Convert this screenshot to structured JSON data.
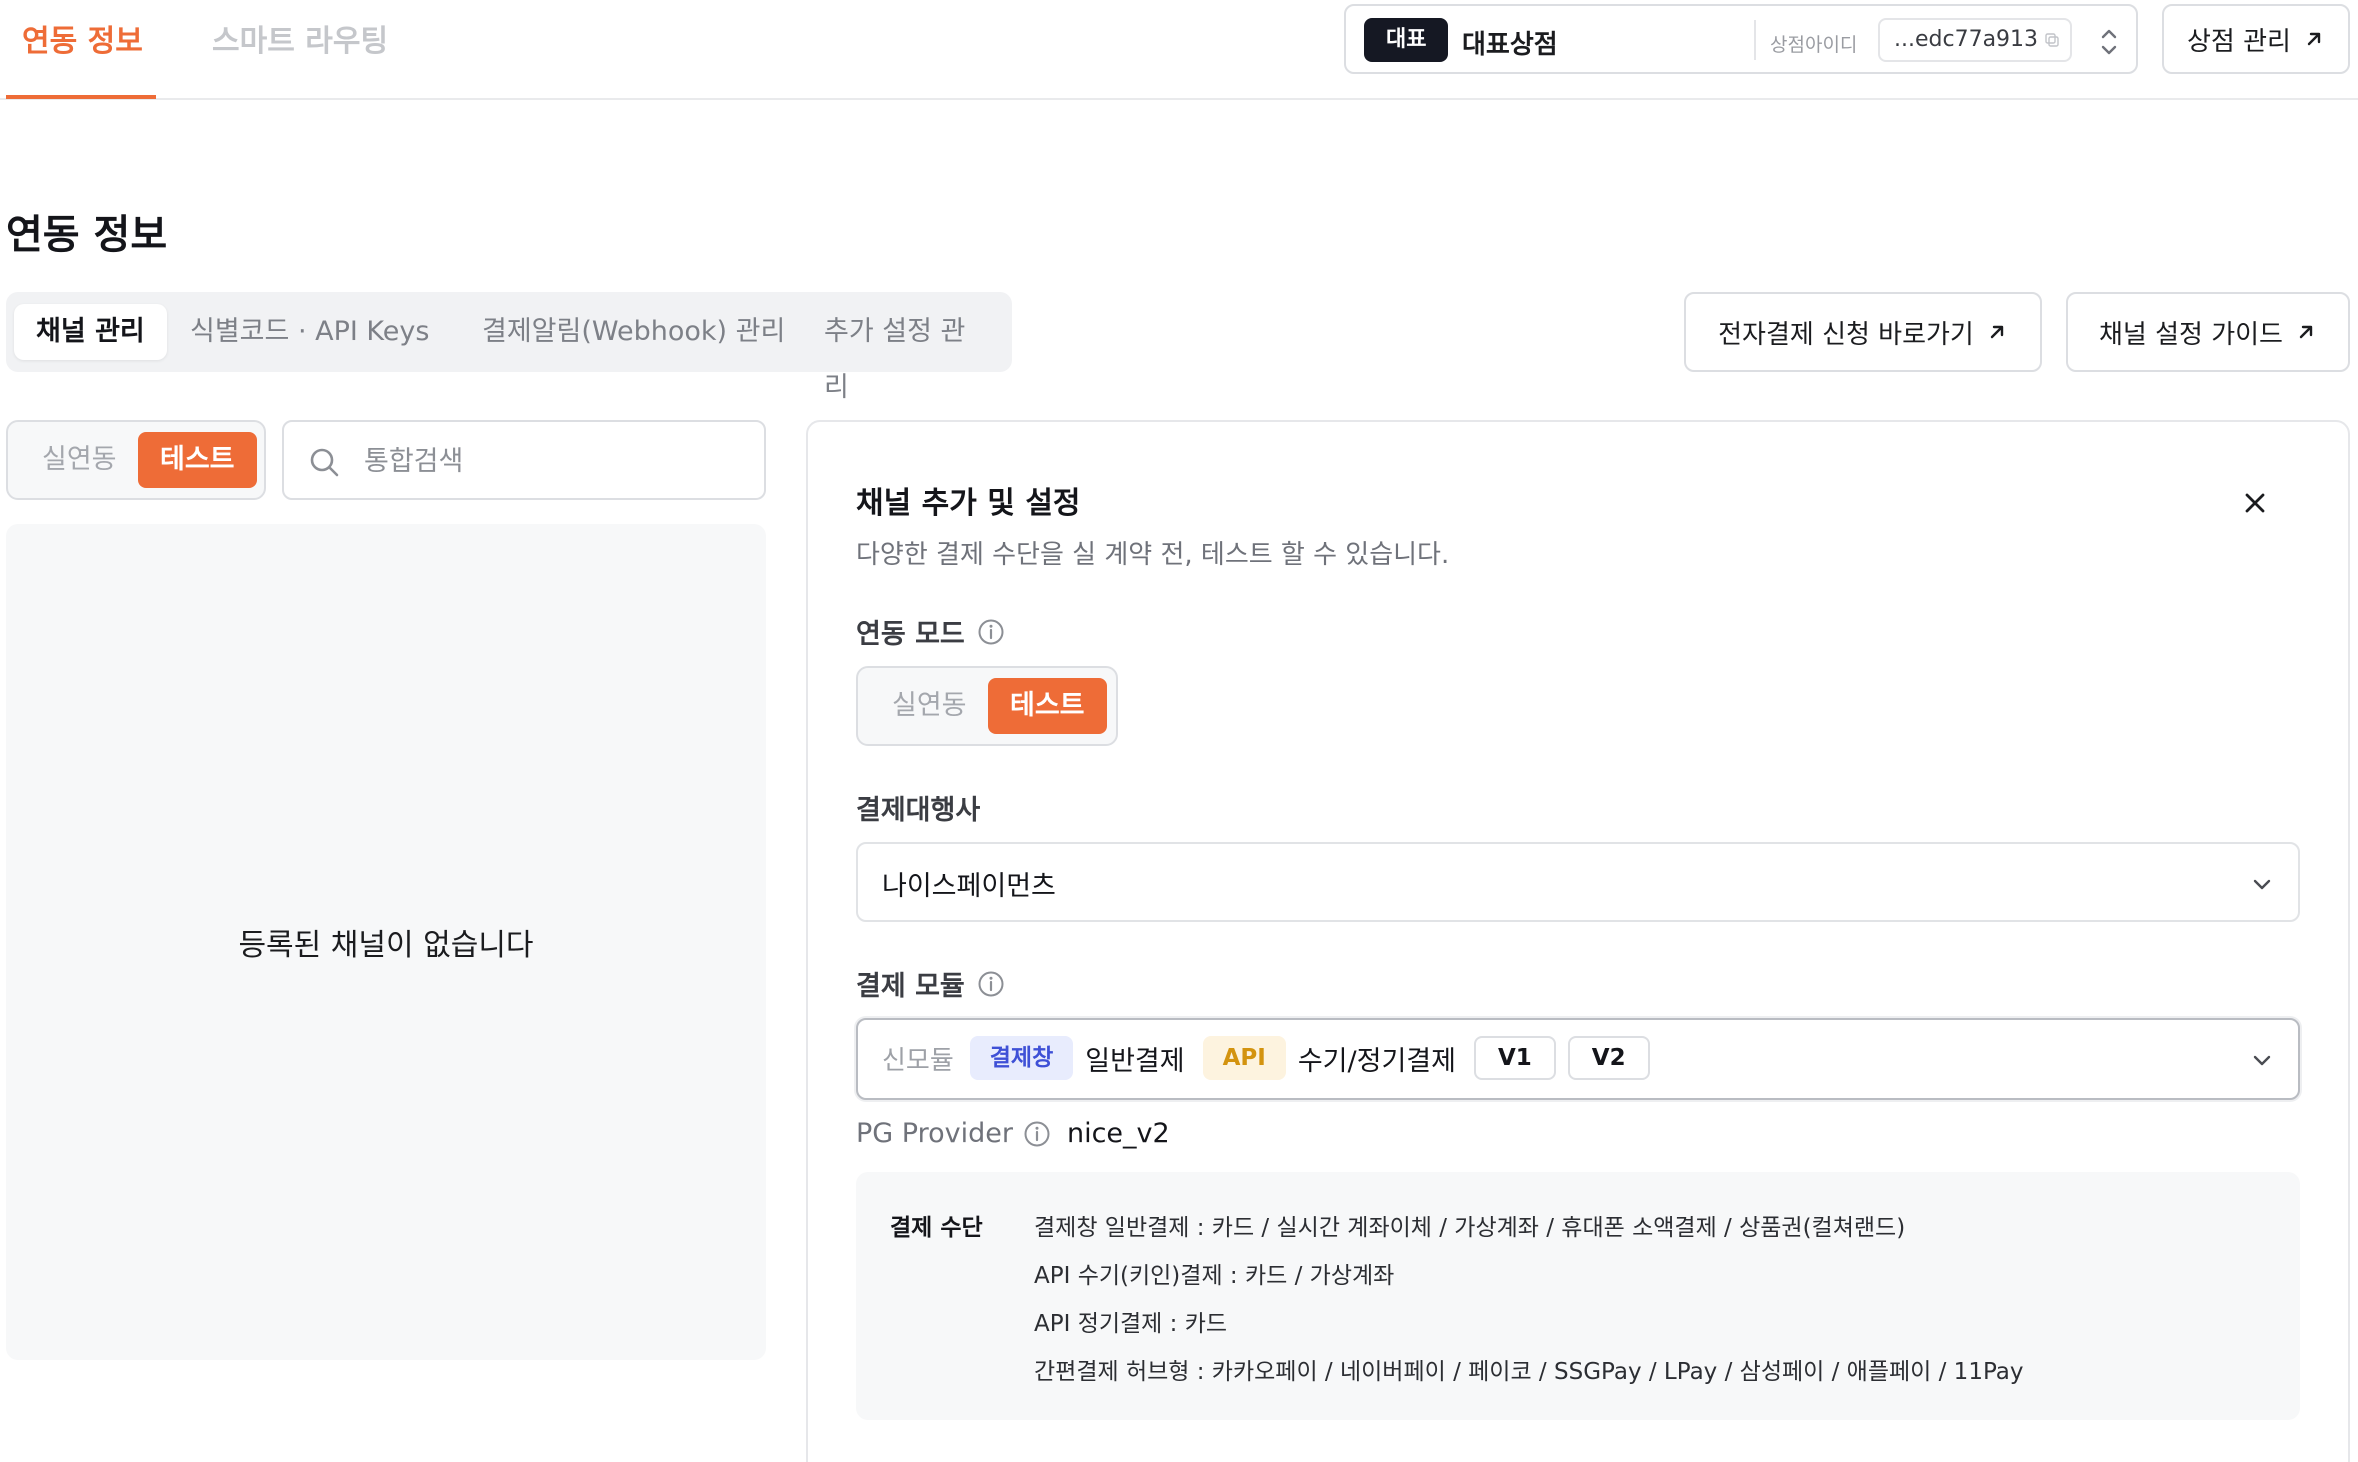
{
  "top_nav": {
    "tabs": [
      {
        "label": "연동 정보",
        "active": true
      },
      {
        "label": "스마트 라우팅",
        "active": false
      }
    ]
  },
  "store_selector": {
    "badge": "대표",
    "store_name": "대표상점",
    "id_label": "상점아이디",
    "id_value": "...edc77a913"
  },
  "store_manage_button": "상점 관리",
  "page_title": "연동 정보",
  "sub_tabs": [
    {
      "label": "채널 관리",
      "active": true
    },
    {
      "label": "식별코드 · API Keys",
      "active": false
    },
    {
      "label": "결제알림(Webhook) 관리",
      "active": false
    },
    {
      "label": "추가 설정 관리",
      "active": false
    }
  ],
  "actions": {
    "apply_link": "전자결제 신청 바로가기",
    "guide_link": "채널 설정 가이드"
  },
  "list_filter": {
    "mode_options": [
      "실연동",
      "테스트"
    ],
    "selected_mode": "테스트",
    "search_placeholder": "통합검색",
    "search_value": ""
  },
  "empty_state": "등록된 채널이 없습니다",
  "drawer": {
    "title": "채널 추가 및 설정",
    "description": "다양한 결제 수단을 실 계약 전, 테스트 할 수 있습니다.",
    "mode_label": "연동 모드",
    "mode_options": [
      "실연동",
      "테스트"
    ],
    "selected_mode": "테스트",
    "pg_label": "결제대행사",
    "pg_value": "나이스페이먼츠",
    "module_label": "결제 모듈",
    "module": {
      "new_label": "신모듈",
      "chip_window": "결제창",
      "text_general": "일반결제",
      "chip_api": "API",
      "text_recurring": "수기/정기결제",
      "versions": [
        "V1",
        "V2"
      ]
    },
    "pg_provider_label": "PG Provider",
    "pg_provider_value": "nice_v2",
    "methods_label": "결제 수단",
    "methods": [
      "결제창 일반결제 : 카드 / 실시간 계좌이체 / 가상계좌 / 휴대폰 소액결제 / 상품권(컬쳐랜드)",
      "API 수기(키인)결제 : 카드 / 가상계좌",
      "API 정기결제 : 카드",
      "간편결제 허브형 : 카카오페이 / 네이버페이 / 페이코 / SSGPay / LPay / 삼성페이 / 애플페이 / 11Pay"
    ]
  },
  "colors": {
    "accent": "#ee6c37",
    "badge_dark": "#151823",
    "chip_purple_bg": "#e8ecfd",
    "chip_purple_text": "#3e50d6",
    "chip_amber_bg": "#fdf3df",
    "chip_amber_text": "#d3930f"
  }
}
